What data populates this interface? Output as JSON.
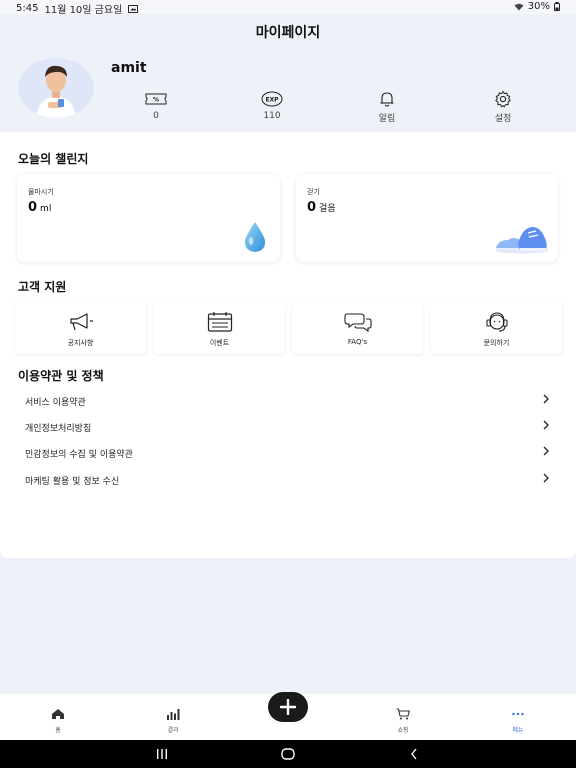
{
  "status_bar": {
    "time": "5:45",
    "date": "11월 10일 금요일",
    "battery": "30%"
  },
  "header": {
    "title": "마이페이지",
    "username": "amit",
    "stats": [
      {
        "icon": "coupon-icon",
        "label": "0"
      },
      {
        "icon": "exp-icon",
        "label": "110"
      },
      {
        "icon": "bell-icon",
        "label": "알림"
      },
      {
        "icon": "gear-icon",
        "label": "설정"
      }
    ]
  },
  "challenge": {
    "title": "오늘의 챌린지",
    "water": {
      "label": "물마시기",
      "value": "0",
      "unit": "ml"
    },
    "walk": {
      "label": "걷기",
      "value": "0",
      "unit": "걸음"
    }
  },
  "support": {
    "title": "고객 지원",
    "items": [
      {
        "icon": "megaphone-icon",
        "label": "공지사항"
      },
      {
        "icon": "calendar-icon",
        "label": "이벤트"
      },
      {
        "icon": "chat-bubbles-icon",
        "label": "FAQ's"
      },
      {
        "icon": "headset-icon",
        "label": "문의하기"
      }
    ]
  },
  "policy": {
    "title": "이용약관 및 정책",
    "items": [
      {
        "label": "서비스 이용약관"
      },
      {
        "label": "개인정보처리방침"
      },
      {
        "label": "민감정보의 수집 및 이용약관"
      },
      {
        "label": "마케팅 활용 및 정보 수신"
      }
    ]
  },
  "bottom_nav": {
    "items": [
      {
        "icon": "home-icon",
        "label": "홈"
      },
      {
        "icon": "bar-chart-icon",
        "label": "결과"
      },
      {
        "icon": "cart-icon",
        "label": "쇼핑"
      },
      {
        "icon": "more-icon",
        "label": "메뉴"
      }
    ],
    "active_color": "#3b6fd8"
  }
}
